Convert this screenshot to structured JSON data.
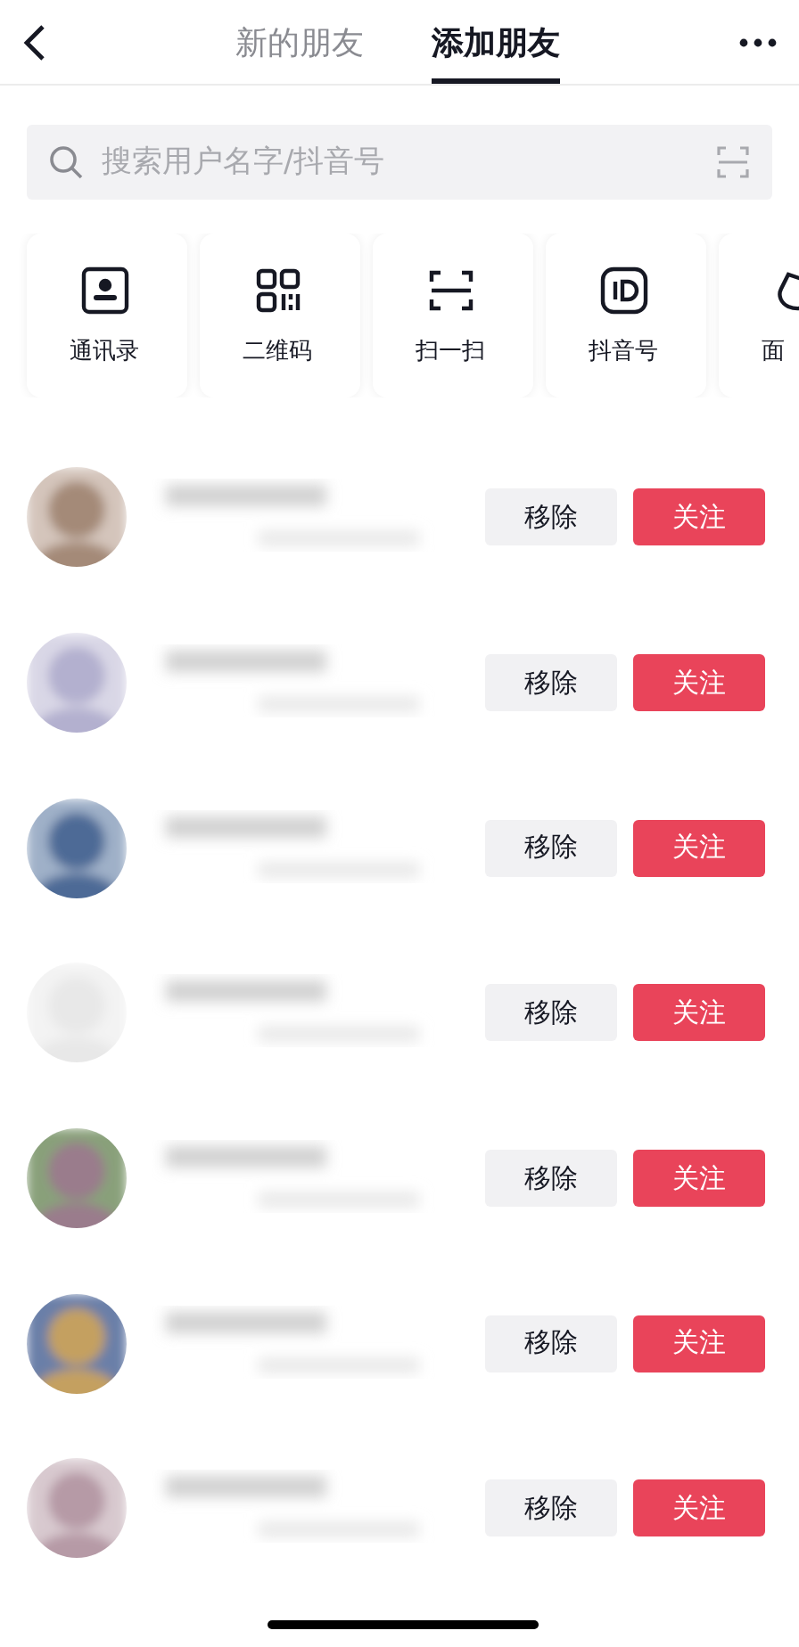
{
  "header": {
    "tabs": [
      {
        "label": "新的朋友",
        "selected": false
      },
      {
        "label": "添加朋友",
        "selected": true
      }
    ]
  },
  "search": {
    "placeholder": "搜索用户名字/抖音号"
  },
  "shortcuts": [
    {
      "kind": "contacts",
      "label": "通讯录"
    },
    {
      "kind": "qr",
      "label": "二维码"
    },
    {
      "kind": "scan",
      "label": "扫一扫"
    },
    {
      "kind": "id",
      "label": "抖音号"
    },
    {
      "kind": "face",
      "label": "面"
    }
  ],
  "friends": [
    {
      "remove": "移除",
      "follow": "关注"
    },
    {
      "remove": "移除",
      "follow": "关注"
    },
    {
      "remove": "移除",
      "follow": "关注"
    },
    {
      "remove": "移除",
      "follow": "关注"
    },
    {
      "remove": "移除",
      "follow": "关注"
    },
    {
      "remove": "移除",
      "follow": "关注"
    },
    {
      "remove": "移除",
      "follow": "关注"
    }
  ]
}
